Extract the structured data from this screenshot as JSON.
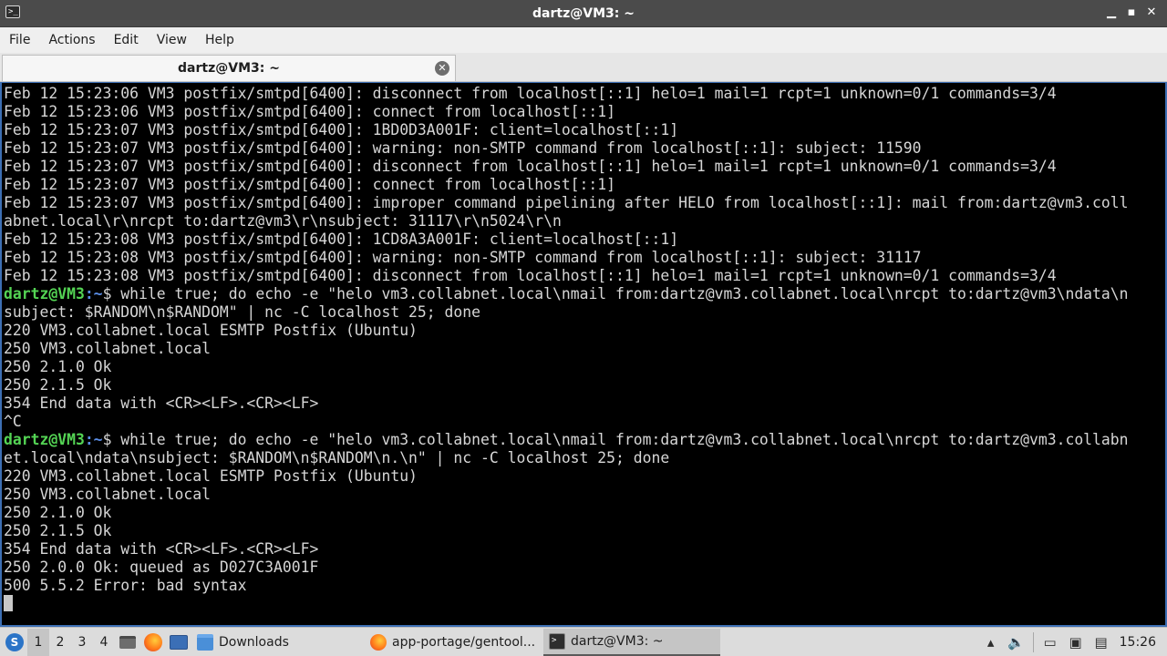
{
  "window": {
    "title": "dartz@VM3: ~",
    "controls": {
      "minimize": "▁",
      "maximize": "▪",
      "close": "✕"
    }
  },
  "menubar": {
    "items": [
      "File",
      "Actions",
      "Edit",
      "View",
      "Help"
    ]
  },
  "tabs": [
    {
      "label": "dartz@VM3: ~",
      "close": "✕"
    }
  ],
  "terminal": {
    "prompt_user": "dartz@VM3",
    "prompt_path": ":~",
    "prompt_suffix": "$",
    "lines": [
      {
        "type": "out",
        "text": "Feb 12 15:23:06 VM3 postfix/smtpd[6400]: disconnect from localhost[::1] helo=1 mail=1 rcpt=1 unknown=0/1 commands=3/4"
      },
      {
        "type": "out",
        "text": "Feb 12 15:23:06 VM3 postfix/smtpd[6400]: connect from localhost[::1]"
      },
      {
        "type": "out",
        "text": "Feb 12 15:23:07 VM3 postfix/smtpd[6400]: 1BD0D3A001F: client=localhost[::1]"
      },
      {
        "type": "out",
        "text": "Feb 12 15:23:07 VM3 postfix/smtpd[6400]: warning: non-SMTP command from localhost[::1]: subject: 11590"
      },
      {
        "type": "out",
        "text": "Feb 12 15:23:07 VM3 postfix/smtpd[6400]: disconnect from localhost[::1] helo=1 mail=1 rcpt=1 unknown=0/1 commands=3/4"
      },
      {
        "type": "out",
        "text": "Feb 12 15:23:07 VM3 postfix/smtpd[6400]: connect from localhost[::1]"
      },
      {
        "type": "out",
        "text": "Feb 12 15:23:07 VM3 postfix/smtpd[6400]: improper command pipelining after HELO from localhost[::1]: mail from:dartz@vm3.coll"
      },
      {
        "type": "out",
        "text": "abnet.local\\r\\nrcpt to:dartz@vm3\\r\\nsubject: 31117\\r\\n5024\\r\\n"
      },
      {
        "type": "out",
        "text": "Feb 12 15:23:08 VM3 postfix/smtpd[6400]: 1CD8A3A001F: client=localhost[::1]"
      },
      {
        "type": "out",
        "text": "Feb 12 15:23:08 VM3 postfix/smtpd[6400]: warning: non-SMTP command from localhost[::1]: subject: 31117"
      },
      {
        "type": "out",
        "text": "Feb 12 15:23:08 VM3 postfix/smtpd[6400]: disconnect from localhost[::1] helo=1 mail=1 rcpt=1 unknown=0/1 commands=3/4"
      },
      {
        "type": "cmd",
        "text": " while true; do echo -e \"helo vm3.collabnet.local\\nmail from:dartz@vm3.collabnet.local\\nrcpt to:dartz@vm3\\ndata\\n"
      },
      {
        "type": "out",
        "text": "subject: $RANDOM\\n$RANDOM\" | nc -C localhost 25; done"
      },
      {
        "type": "out",
        "text": "220 VM3.collabnet.local ESMTP Postfix (Ubuntu)"
      },
      {
        "type": "out",
        "text": "250 VM3.collabnet.local"
      },
      {
        "type": "out",
        "text": "250 2.1.0 Ok"
      },
      {
        "type": "out",
        "text": "250 2.1.5 Ok"
      },
      {
        "type": "out",
        "text": "354 End data with <CR><LF>.<CR><LF>"
      },
      {
        "type": "out",
        "text": "^C"
      },
      {
        "type": "cmd",
        "text": " while true; do echo -e \"helo vm3.collabnet.local\\nmail from:dartz@vm3.collabnet.local\\nrcpt to:dartz@vm3.collabn"
      },
      {
        "type": "out",
        "text": "et.local\\ndata\\nsubject: $RANDOM\\n$RANDOM\\n.\\n\" | nc -C localhost 25; done"
      },
      {
        "type": "out",
        "text": "220 VM3.collabnet.local ESMTP Postfix (Ubuntu)"
      },
      {
        "type": "out",
        "text": "250 VM3.collabnet.local"
      },
      {
        "type": "out",
        "text": "250 2.1.0 Ok"
      },
      {
        "type": "out",
        "text": "250 2.1.5 Ok"
      },
      {
        "type": "out",
        "text": "354 End data with <CR><LF>.<CR><LF>"
      },
      {
        "type": "out",
        "text": "250 2.0.0 Ok: queued as D027C3A001F"
      },
      {
        "type": "out",
        "text": "500 5.5.2 Error: bad syntax"
      }
    ]
  },
  "taskbar": {
    "workspaces": [
      "1",
      "2",
      "3",
      "4"
    ],
    "active_workspace": "1",
    "tasks": [
      {
        "label": "Downloads",
        "icon": "folder-icon"
      },
      {
        "label": "app-portage/gentool...",
        "icon": "firefox-icon"
      },
      {
        "label": "dartz@VM3: ~",
        "icon": "terminal-icon"
      }
    ],
    "clock": "15:26"
  },
  "colors": {
    "prompt_user": "#54d454",
    "prompt_path": "#5a8de6",
    "terminal_bg": "#000000",
    "terminal_fg": "#d6d6d6"
  }
}
